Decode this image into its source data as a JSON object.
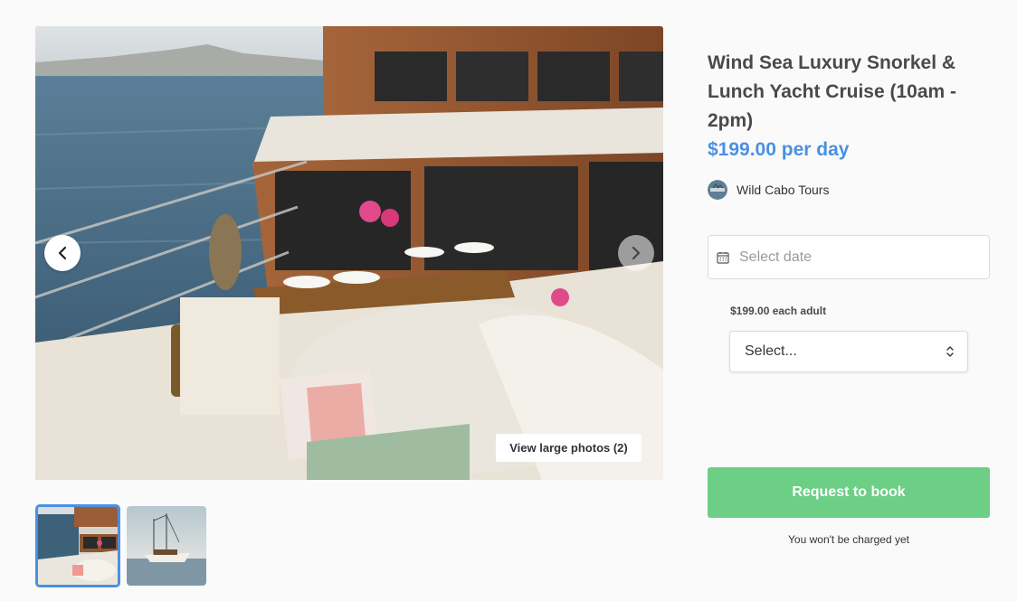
{
  "gallery": {
    "prev_icon": "chevron-left-icon",
    "next_icon": "chevron-right-icon",
    "view_large_label": "View large photos (2)",
    "thumbnails": [
      {
        "name": "yacht-deck-lounge",
        "selected": true
      },
      {
        "name": "yacht-on-water",
        "selected": false
      }
    ]
  },
  "listing": {
    "title": "Wind Sea Luxury Snorkel & Lunch Yacht Cruise (10am - 2pm)",
    "price": "$199.00 per day",
    "operator": "Wild Cabo Tours"
  },
  "booking": {
    "date_icon": "calendar-icon",
    "date_placeholder": "Select date",
    "adult_label": "$199.00 each adult",
    "adult_select_value": "Select...",
    "book_label": "Request to book",
    "charge_note": "You won't be charged yet"
  },
  "colors": {
    "accent": "#4a90e2",
    "book_button": "#6ccf85",
    "background": "#fafafa"
  }
}
